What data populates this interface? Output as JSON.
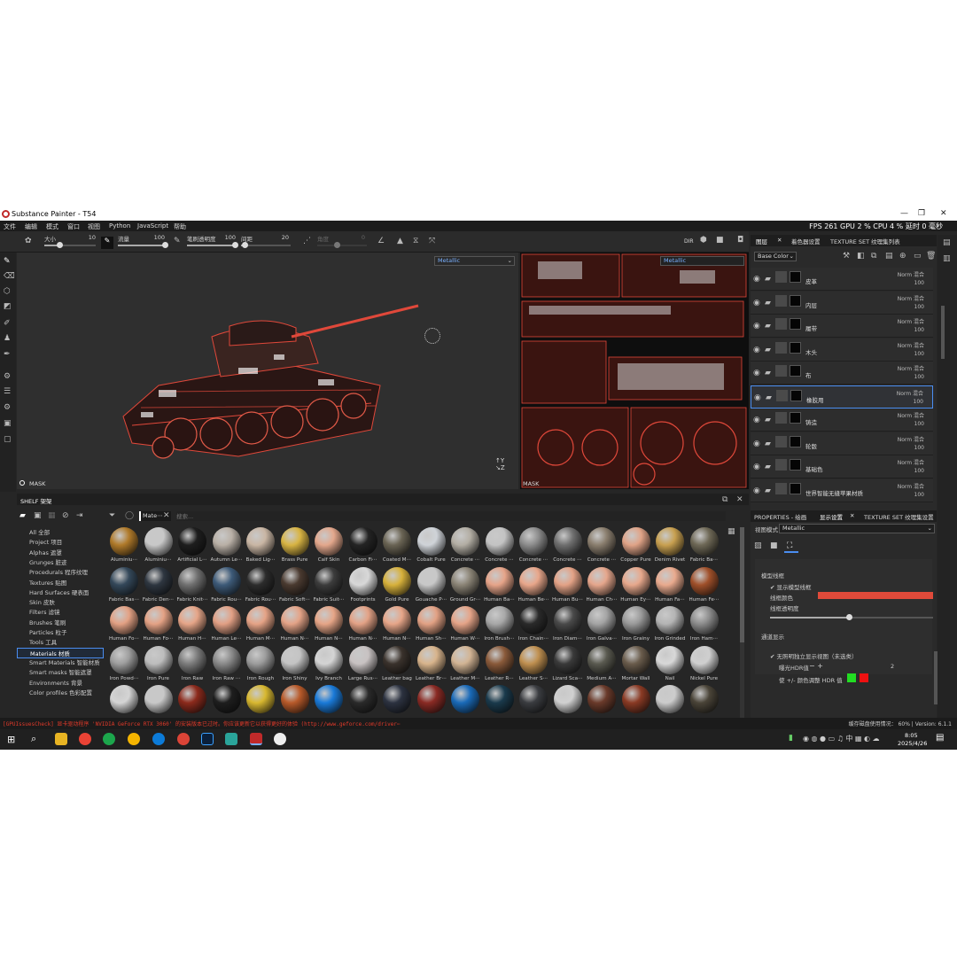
{
  "window": {
    "title": "Substance Painter - T54"
  },
  "menu": [
    "文件",
    "编辑",
    "模式",
    "窗口",
    "视图",
    "Python",
    "JavaScript",
    "帮助"
  ],
  "perf": {
    "text": "FPS 261 GPU 2 % CPU 4 % 延时 0 毫秒"
  },
  "toolbar": {
    "size_label": "大小",
    "size_value": "10",
    "flow_label": "流量",
    "flow_value": "100",
    "stroke_opacity_label": "笔刷透明度",
    "stroke_opacity_value": "100",
    "spacing_label": "间距",
    "spacing_value": "20",
    "angle_label": "角度",
    "angle_value": "0",
    "dir_label": "DIR"
  },
  "viewport3d": {
    "mode": "Metallic",
    "footer": "MASK"
  },
  "viewport2d": {
    "mode": "Metallic",
    "footer": "MASK"
  },
  "layers_panel": {
    "tabs": [
      "图层",
      "着色器设置",
      "TEXTURE SET 纹理集列表"
    ],
    "channel": "Base Color",
    "layers": [
      {
        "name": "皮革",
        "blend": "Norm 混合",
        "opacity": "100"
      },
      {
        "name": "内层",
        "blend": "Norm 混合",
        "opacity": "100"
      },
      {
        "name": "履带",
        "blend": "Norm 混合",
        "opacity": "100"
      },
      {
        "name": "木头",
        "blend": "Norm 混合",
        "opacity": "100"
      },
      {
        "name": "布",
        "blend": "Norm 混合",
        "opacity": "100"
      },
      {
        "name": "橡胶用",
        "blend": "Norm 混合",
        "opacity": "100"
      },
      {
        "name": "铸造",
        "blend": "Norm 混合",
        "opacity": "100"
      },
      {
        "name": "轮毂",
        "blend": "Norm 混合",
        "opacity": "100"
      },
      {
        "name": "基础色",
        "blend": "Norm 混合",
        "opacity": "100"
      },
      {
        "name": "世界智能无缝苹果材质",
        "blend": "Norm 混合",
        "opacity": "100"
      }
    ]
  },
  "props_panel": {
    "tabs": [
      "PROPERTIES - 绘画",
      "显示设置",
      "TEXTURE SET 纹理集设置"
    ],
    "view_mode_label": "视图模式",
    "view_mode_value": "Metallic",
    "wire_section": "模型线框",
    "show_wire": "显示模型线框",
    "wire_color": "线框颜色",
    "wire_opacity": "线框透明度",
    "color_section": "通道显示",
    "iso_channel": "无照明独立显示视图（未选类）",
    "hdr_label": "曝光HDR值",
    "hdr_value": "2",
    "hdr_adj": "使 +/- 颜色调整 HDR 值",
    "wire_hex": "#e04a3a",
    "green": "#22dd22",
    "red": "#ee1111"
  },
  "shelf": {
    "title": "SHELF 架架",
    "filter_tag": "Mate⋯",
    "search_placeholder": "搜索...",
    "categories": [
      "All 全部",
      "Project 项目",
      "Alphas 遮罩",
      "Grunges 脏迹",
      "Procedurals 程序纹理",
      "Textures 贴图",
      "Hard Surfaces 硬表面",
      "Skin 皮肤",
      "Filters 滤镜",
      "Brushes 笔刷",
      "Particles 粒子",
      "Tools 工具",
      "Materials 材质",
      "Smart Materials 智能材质",
      "Smart masks 智能遮罩",
      "Environments 背景",
      "Color profiles 色彩配置"
    ],
    "active_category": "Materials 材质",
    "materials": [
      {
        "name": "Aluminiu⋯",
        "color": "#b07a2a"
      },
      {
        "name": "Aluminiu⋯",
        "color": "#c8c8c8"
      },
      {
        "name": "Artificial L⋯",
        "color": "#1e1e1e"
      },
      {
        "name": "Autumn Le⋯",
        "color": "#b9b0a6"
      },
      {
        "name": "Baked Lig⋯",
        "color": "#c9b6a4"
      },
      {
        "name": "Brass Pure",
        "color": "#d8b443"
      },
      {
        "name": "Calf Skin",
        "color": "#e3a78c"
      },
      {
        "name": "Carbon Fi⋯",
        "color": "#242424"
      },
      {
        "name": "Coated M⋯",
        "color": "#6a6454"
      },
      {
        "name": "Cobalt Pure",
        "color": "#cfd3d8"
      },
      {
        "name": "Concrete ⋯",
        "color": "#b3aea4"
      },
      {
        "name": "Concrete ⋯",
        "color": "#c4c4c4"
      },
      {
        "name": "Concrete ⋯",
        "color": "#8c8c8c"
      },
      {
        "name": "Concrete ⋯",
        "color": "#6f6f6f"
      },
      {
        "name": "Concrete ⋯",
        "color": "#8a7e6e"
      },
      {
        "name": "Copper Pure",
        "color": "#e0a387"
      },
      {
        "name": "Denim Rivet",
        "color": "#c8a050"
      },
      {
        "name": "Fabric Ba⋯",
        "color": "#6e6856"
      },
      {
        "name": "Fabric Bas⋯",
        "color": "#34485a"
      },
      {
        "name": "Fabric Den⋯",
        "color": "#2e3640"
      },
      {
        "name": "Fabric Knit⋯",
        "color": "#707070"
      },
      {
        "name": "Fabric Rou⋯",
        "color": "#3d5a78"
      },
      {
        "name": "Fabric Rou⋯",
        "color": "#2c2c2c"
      },
      {
        "name": "Fabric Soft⋯",
        "color": "#4a3a30"
      },
      {
        "name": "Fabric Suit⋯",
        "color": "#3c3c3c"
      },
      {
        "name": "Footprints",
        "color": "#d8d8d8"
      },
      {
        "name": "Gold Pure",
        "color": "#d7b13b"
      },
      {
        "name": "Gouache P⋯",
        "color": "#c8c8c8"
      },
      {
        "name": "Ground Gr⋯",
        "color": "#8b8476"
      },
      {
        "name": "Human Ba⋯",
        "color": "#e6a489"
      },
      {
        "name": "Human Be⋯",
        "color": "#e8a68a"
      },
      {
        "name": "Human Bu⋯",
        "color": "#e3a286"
      },
      {
        "name": "Human Ch⋯",
        "color": "#e5a68c"
      },
      {
        "name": "Human Ey⋯",
        "color": "#e7a88c"
      },
      {
        "name": "Human Fa⋯",
        "color": "#e9aa8e"
      },
      {
        "name": "Human Fe⋯",
        "color": "#a0502a"
      },
      {
        "name": "Human Fo⋯",
        "color": "#e3a184"
      },
      {
        "name": "Human Fo⋯",
        "color": "#e4a285"
      },
      {
        "name": "Human H⋯",
        "color": "#e6a588"
      },
      {
        "name": "Human Le⋯",
        "color": "#e2a085"
      },
      {
        "name": "Human M⋯",
        "color": "#e5a386"
      },
      {
        "name": "Human N⋯",
        "color": "#e4a387"
      },
      {
        "name": "Human N⋯",
        "color": "#e6a587"
      },
      {
        "name": "Human N⋯",
        "color": "#e3a286"
      },
      {
        "name": "Human N⋯",
        "color": "#e7a689"
      },
      {
        "name": "Human Sh⋯",
        "color": "#e2a184"
      },
      {
        "name": "Human W⋯",
        "color": "#e5a488"
      },
      {
        "name": "Iron Brush⋯",
        "color": "#a8a8a8"
      },
      {
        "name": "Iron Chain⋯",
        "color": "#2a2a2a"
      },
      {
        "name": "Iron Diam⋯",
        "color": "#4a4a4a"
      },
      {
        "name": "Iron Galva⋯",
        "color": "#a4a4a4"
      },
      {
        "name": "Iron Grainy",
        "color": "#9a9a9a"
      },
      {
        "name": "Iron Grinded",
        "color": "#b4b4b4"
      },
      {
        "name": "Iron Ham⋯",
        "color": "#8c8c8c"
      },
      {
        "name": "Iron Powd⋯",
        "color": "#9e9e9e"
      },
      {
        "name": "Iron Pure",
        "color": "#bdbdbd"
      },
      {
        "name": "Iron Raw",
        "color": "#7c7c7c"
      },
      {
        "name": "Iron Raw ⋯",
        "color": "#8a8a8a"
      },
      {
        "name": "Iron Rough",
        "color": "#9c9c9c"
      },
      {
        "name": "Iron Shiny",
        "color": "#c4c4c4"
      },
      {
        "name": "Ivy Branch",
        "color": "#d4d4d4"
      },
      {
        "name": "Large Rus⋯",
        "color": "#c8c2c2"
      },
      {
        "name": "Leather bag",
        "color": "#3a322c"
      },
      {
        "name": "Leather Br⋯",
        "color": "#d8b48c"
      },
      {
        "name": "Leather M⋯",
        "color": "#d2b494"
      },
      {
        "name": "Leather R⋯",
        "color": "#8a5a3a"
      },
      {
        "name": "Leather S⋯",
        "color": "#c09050"
      },
      {
        "name": "Lizard Sca⋯",
        "color": "#3a3a3a"
      },
      {
        "name": "Medium A⋯",
        "color": "#5a5a50"
      },
      {
        "name": "Mortar Wall",
        "color": "#6a5c4c"
      },
      {
        "name": "Nail",
        "color": "#d8d8d8"
      },
      {
        "name": "Nickel Pure",
        "color": "#cfcfcf"
      },
      {
        "name": "",
        "color": "#d4d4d4"
      },
      {
        "name": "",
        "color": "#c8c8c8"
      },
      {
        "name": "",
        "color": "#8c2a1c"
      },
      {
        "name": "",
        "color": "#1e1e1e"
      },
      {
        "name": "",
        "color": "#d8b830"
      },
      {
        "name": "",
        "color": "#b85a2a"
      },
      {
        "name": "",
        "color": "#1a7ad8"
      },
      {
        "name": "",
        "color": "#2a2a2a"
      },
      {
        "name": "",
        "color": "#2c3240"
      },
      {
        "name": "",
        "color": "#8a2a24"
      },
      {
        "name": "",
        "color": "#1a6ab8"
      },
      {
        "name": "",
        "color": "#1a3a4c"
      },
      {
        "name": "",
        "color": "#3a3c40"
      },
      {
        "name": "",
        "color": "#d0d0d0"
      },
      {
        "name": "",
        "color": "#6a3a2a"
      },
      {
        "name": "",
        "color": "#8a3a24"
      },
      {
        "name": "",
        "color": "#cccccc"
      },
      {
        "name": "",
        "color": "#4a4438"
      }
    ]
  },
  "status": {
    "message": "[GPUIssuesCheck] 显卡驱动程序 'NVIDIA GeForce RTX 3060' 的安装版本已过时。你应该更新它以获得更好的体验 (http://www.geforce.com/driver⋯",
    "disk": "缓存磁盘使用情况： 60% | Version: 6.1.1"
  },
  "taskbar": {
    "time": "8:05",
    "date": "2025/4/26"
  }
}
